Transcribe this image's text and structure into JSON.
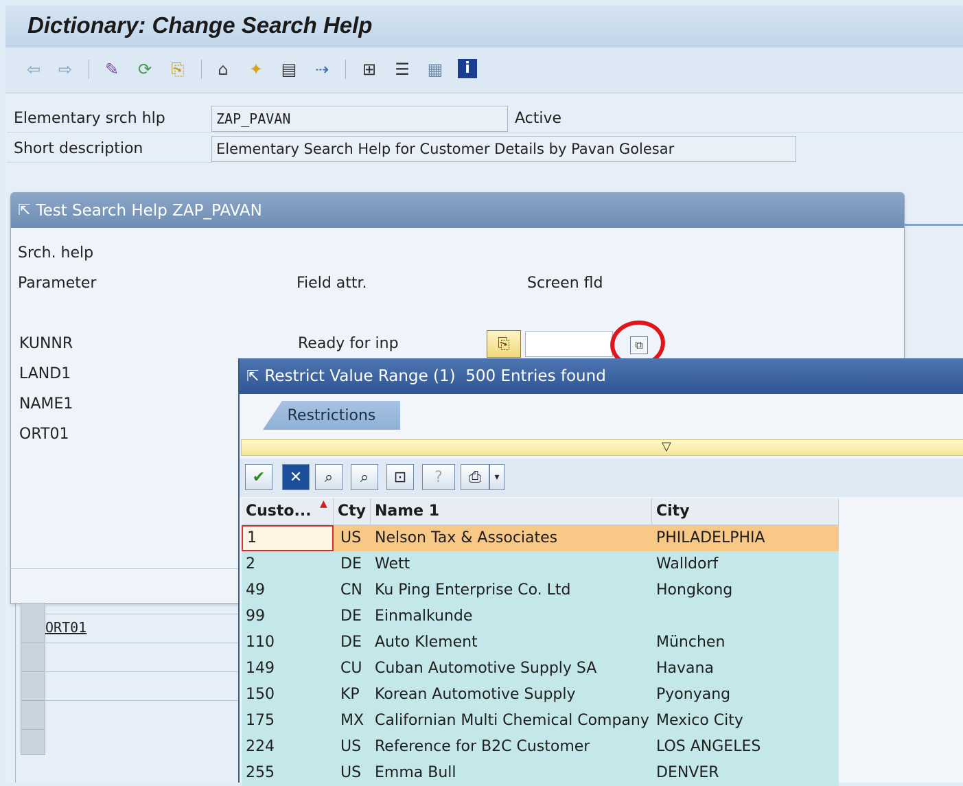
{
  "window": {
    "title": "Dictionary: Change Search Help"
  },
  "toolbar": {
    "icons": [
      "back-arrow-icon",
      "forward-arrow-icon",
      "display-change-icon",
      "check-icon",
      "activate-icon",
      "where-used-icon",
      "new-object-icon",
      "insert-icon",
      "display-object-list-icon",
      "navigate-icon",
      "hierarchy-icon",
      "stack-icon",
      "list-icon",
      "info-icon"
    ]
  },
  "form": {
    "elementary_label": "Elementary srch hlp",
    "elementary_value": "ZAP_PAVAN",
    "status": "Active",
    "short_desc_label": "Short description",
    "short_desc_value": "Elementary Search Help for Customer Details by Pavan Golesar"
  },
  "test_dialog": {
    "title": "Test Search Help ZAP_PAVAN",
    "srch_help_label": "Srch. help",
    "col_parameter": "Parameter",
    "col_field_attr": "Field attr.",
    "col_screen_fld": "Screen fld",
    "params": [
      "KUNNR",
      "LAND1",
      "NAME1",
      "ORT01"
    ],
    "kunnr_attr": "Ready for inp",
    "behind_row_label": "ORT01"
  },
  "value_dialog": {
    "title": "Restrict Value Range (1)  500 Entries found",
    "tab_label": "Restrictions",
    "columns": [
      "Custo...",
      "Cty",
      "Name 1",
      "City"
    ],
    "rows": [
      {
        "cust": "1",
        "cty": "US",
        "name": "Nelson Tax & Associates",
        "city": "PHILADELPHIA"
      },
      {
        "cust": "2",
        "cty": "DE",
        "name": "Wett",
        "city": "Walldorf"
      },
      {
        "cust": "49",
        "cty": "CN",
        "name": "Ku Ping Enterprise Co. Ltd",
        "city": "Hongkong"
      },
      {
        "cust": "99",
        "cty": "DE",
        "name": "Einmalkunde",
        "city": ""
      },
      {
        "cust": "110",
        "cty": "DE",
        "name": "Auto Klement",
        "city": "München"
      },
      {
        "cust": "149",
        "cty": "CU",
        "name": "Cuban Automotive Supply SA",
        "city": "Havana"
      },
      {
        "cust": "150",
        "cty": "KP",
        "name": "Korean Automotive Supply",
        "city": "Pyonyang"
      },
      {
        "cust": "175",
        "cty": "MX",
        "name": "Californian Multi Chemical Company",
        "city": "Mexico City"
      },
      {
        "cust": "224",
        "cty": "US",
        "name": "Reference for B2C Customer",
        "city": "LOS ANGELES"
      },
      {
        "cust": "255",
        "cty": "US",
        "name": "Emma Bull",
        "city": "DENVER"
      }
    ]
  },
  "colors": {
    "selected_row": "#f8c887",
    "row_bg": "#c4e8ea",
    "highlight_circle": "#e0141b"
  }
}
